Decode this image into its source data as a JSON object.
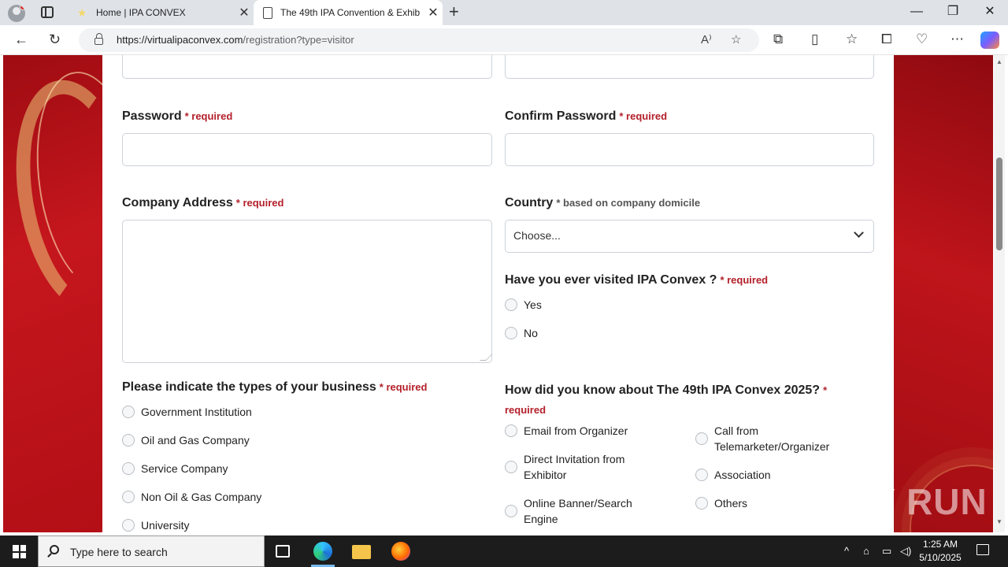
{
  "browser": {
    "tabs": [
      {
        "title": "Home | IPA CONVEX"
      },
      {
        "title": "The 49th IPA Convention & Exhib"
      }
    ],
    "url_host": "https://virtualipaconvex.com",
    "url_path": "/registration?type=visitor"
  },
  "form": {
    "password": {
      "label": "Password",
      "required": "* required"
    },
    "confirm_password": {
      "label": "Confirm Password",
      "required": "* required"
    },
    "company_address": {
      "label": "Company Address",
      "required": "* required"
    },
    "country": {
      "label": "Country",
      "note": "* based on company domicile",
      "selected": "Choose..."
    },
    "visited": {
      "label": "Have you ever visited IPA Convex ?",
      "required": "* required",
      "options": [
        "Yes",
        "No"
      ]
    },
    "business_types": {
      "label": "Please indicate the types of your business",
      "required": "* required",
      "options": [
        "Government Institution",
        "Oil and Gas Company",
        "Service Company",
        "Non Oil & Gas Company",
        "University"
      ]
    },
    "how_know": {
      "label": "How did you know about The 49th IPA Convex 2025?",
      "required": "* required",
      "options_left": [
        "Email from Organizer",
        "Direct Invitation from Exhibitor",
        "Online Banner/Search Engine"
      ],
      "options_right": [
        "Call from Telemarketer/Organizer",
        "Association",
        "Others"
      ]
    }
  },
  "watermark": "ANY RUN",
  "taskbar": {
    "search_placeholder": "Type here to search",
    "time": "1:25 AM",
    "date": "5/10/2025"
  }
}
